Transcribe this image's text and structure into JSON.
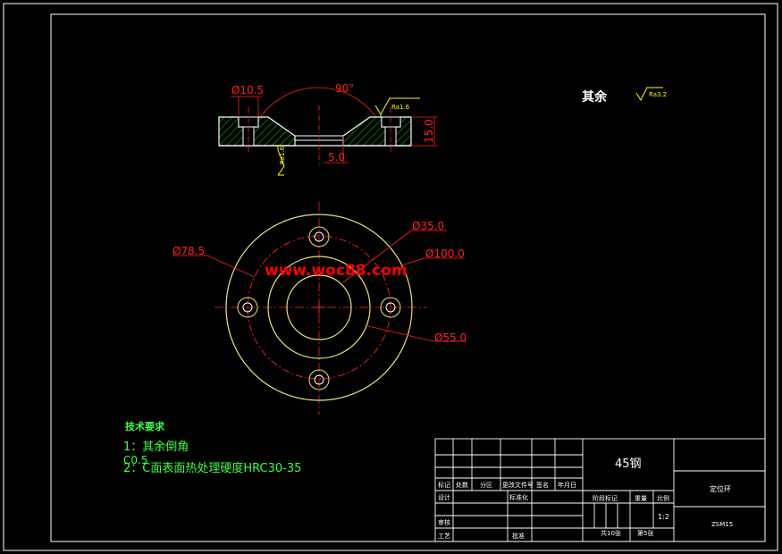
{
  "colors": {
    "background": "#000000",
    "frame": "#ffffff",
    "section": "#ffffff",
    "hatch": "#00c000",
    "dimension": "#ff2020",
    "circle": "#e8e080",
    "centerline": "#ff2020",
    "tech_text": "#40ff40",
    "symbol": "#ffff00",
    "watermark": "#ff0000"
  },
  "section_view": {
    "dim_hole": "Ø10.5",
    "dim_angle": "90°",
    "dim_height": "15.0",
    "dim_depth": "5.0",
    "roughness_right": "Ra1.6",
    "roughness_left": "Ra1.6"
  },
  "surface_note": {
    "label": "其余",
    "roughness": "Ra3.2"
  },
  "plan_view": {
    "dim_d35": "Ø35.0",
    "dim_d100": "Ø100.0",
    "dim_d785": "Ø78.5",
    "dim_d55": "Ø55.0"
  },
  "watermark": "www.woc88.com",
  "tech_requirements": {
    "title": "技术要求",
    "item1": "1：其余倒角",
    "item1_extra": "C0.5",
    "item2": "2：C面表面热处理硬度HRC30-35"
  },
  "title_block": {
    "material": "45钢",
    "part_name": "定位环",
    "drawing_number": "ZSM15",
    "header_cells": [
      "标记",
      "处数",
      "分区",
      "更改文件号",
      "签名",
      "年月日"
    ],
    "rows_left": [
      "设计",
      "审核",
      "工艺"
    ],
    "standard_label": "标准化",
    "approve_label": "批准",
    "stage_label": "阶段标记",
    "weight_label": "重量",
    "scale_label": "比例",
    "scale_value": "1:2",
    "sheets_total": "共10张",
    "sheet_no": "第5张"
  }
}
